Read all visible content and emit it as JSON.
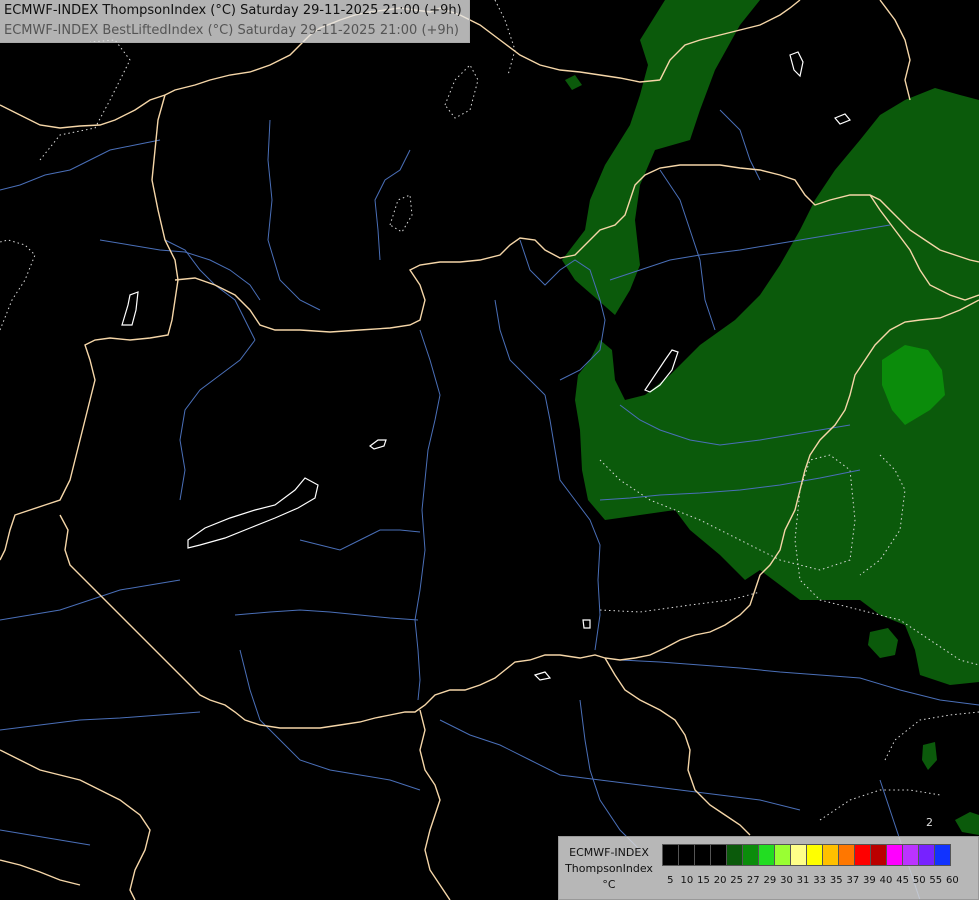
{
  "header": {
    "line1": "ECMWF-INDEX ThompsonIndex (°C) Saturday 29-11-2025 21:00 (+9h)",
    "line2": "ECMWF-INDEX BestLiftedIndex (°C) Saturday 29-11-2025 21:00 (+9h)"
  },
  "legend": {
    "title_line1": "ECMWF-INDEX",
    "title_line2": "ThompsonIndex",
    "unit": "°C",
    "swatches": [
      {
        "value": "5",
        "color": "#000000"
      },
      {
        "value": "10",
        "color": "#000000"
      },
      {
        "value": "15",
        "color": "#000000"
      },
      {
        "value": "20",
        "color": "#000000"
      },
      {
        "value": "25",
        "color": "#0b5a0b"
      },
      {
        "value": "27",
        "color": "#0b8c0b"
      },
      {
        "value": "29",
        "color": "#22dd22"
      },
      {
        "value": "30",
        "color": "#99ff33"
      },
      {
        "value": "31",
        "color": "#ffff88"
      },
      {
        "value": "33",
        "color": "#ffff00"
      },
      {
        "value": "35",
        "color": "#ffc000"
      },
      {
        "value": "37",
        "color": "#ff7700"
      },
      {
        "value": "39",
        "color": "#ff0000"
      },
      {
        "value": "40",
        "color": "#bb0000"
      },
      {
        "value": "45",
        "color": "#ff00ff"
      },
      {
        "value": "50",
        "color": "#bb33ff"
      },
      {
        "value": "55",
        "color": "#7722ff"
      },
      {
        "value": "60",
        "color": "#1133ff"
      }
    ]
  },
  "map": {
    "contour_label": "2",
    "colors": {
      "background": "#000000",
      "fill_dark_green": "#0b5a0b",
      "fill_green": "#0b8c0b",
      "borders": "#f5d6a8",
      "rivers": "#4a6fb8",
      "contours": "#dddddd"
    }
  }
}
